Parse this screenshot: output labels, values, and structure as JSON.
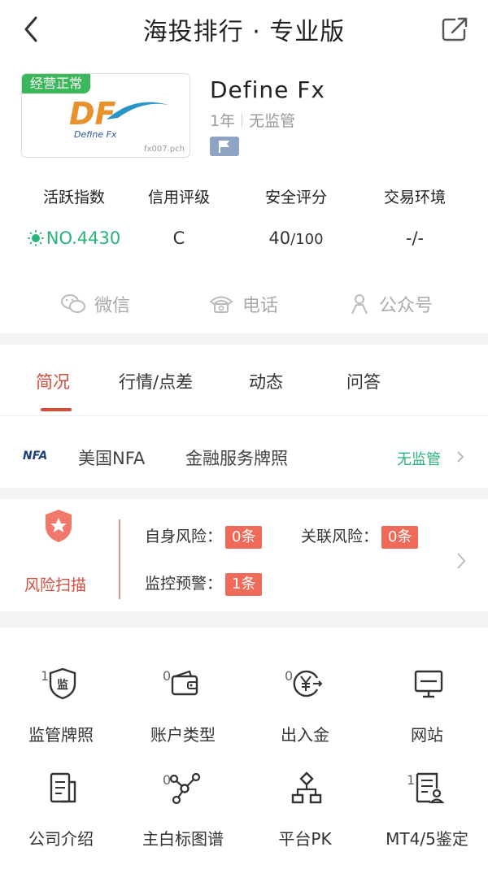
{
  "header": {
    "title": "海投排行 · 专业版"
  },
  "broker": {
    "status_badge": "经营正常",
    "logo_text": "DF",
    "logo_subtext": "Define Fx",
    "logo_code": "fx007.pch",
    "name": "Define Fx",
    "years": "1年",
    "regulation": "无监管"
  },
  "stats": [
    {
      "label": "活跃指数",
      "value": "NO.4430"
    },
    {
      "label": "信用评级",
      "value": "C"
    },
    {
      "label": "安全评分",
      "value": "40",
      "suffix": "/100"
    },
    {
      "label": "交易环境",
      "value": "-/-"
    }
  ],
  "contacts": {
    "wechat": "微信",
    "phone": "电话",
    "official": "公众号"
  },
  "tabs": [
    "简况",
    "行情/点差",
    "动态",
    "问答"
  ],
  "license": {
    "logo": "NFA",
    "region": "美国NFA",
    "type": "金融服务牌照",
    "status": "无监管"
  },
  "risk": {
    "title": "风险扫描",
    "own_label": "自身风险：",
    "own_count": "0条",
    "related_label": "关联风险：",
    "related_count": "0条",
    "monitor_label": "监控预警：",
    "monitor_count": "1条"
  },
  "grid": [
    {
      "label": "监管牌照",
      "count": "1",
      "icon": "regulation-shield-icon"
    },
    {
      "label": "账户类型",
      "count": "0",
      "icon": "wallet-icon"
    },
    {
      "label": "出入金",
      "count": "0",
      "icon": "yen-transfer-icon"
    },
    {
      "label": "网站",
      "count": "",
      "icon": "monitor-icon"
    },
    {
      "label": "公司介绍",
      "count": "",
      "icon": "document-icon"
    },
    {
      "label": "主白标图谱",
      "count": "0",
      "icon": "network-graph-icon"
    },
    {
      "label": "平台PK",
      "count": "",
      "icon": "hierarchy-icon"
    },
    {
      "label": "MT4/5鉴定",
      "count": "1",
      "icon": "certificate-icon"
    }
  ],
  "colors": {
    "accent_red": "#d24d3c",
    "green": "#28b478",
    "badge_green": "#3cb85c",
    "risk_badge": "#f06a5a"
  }
}
